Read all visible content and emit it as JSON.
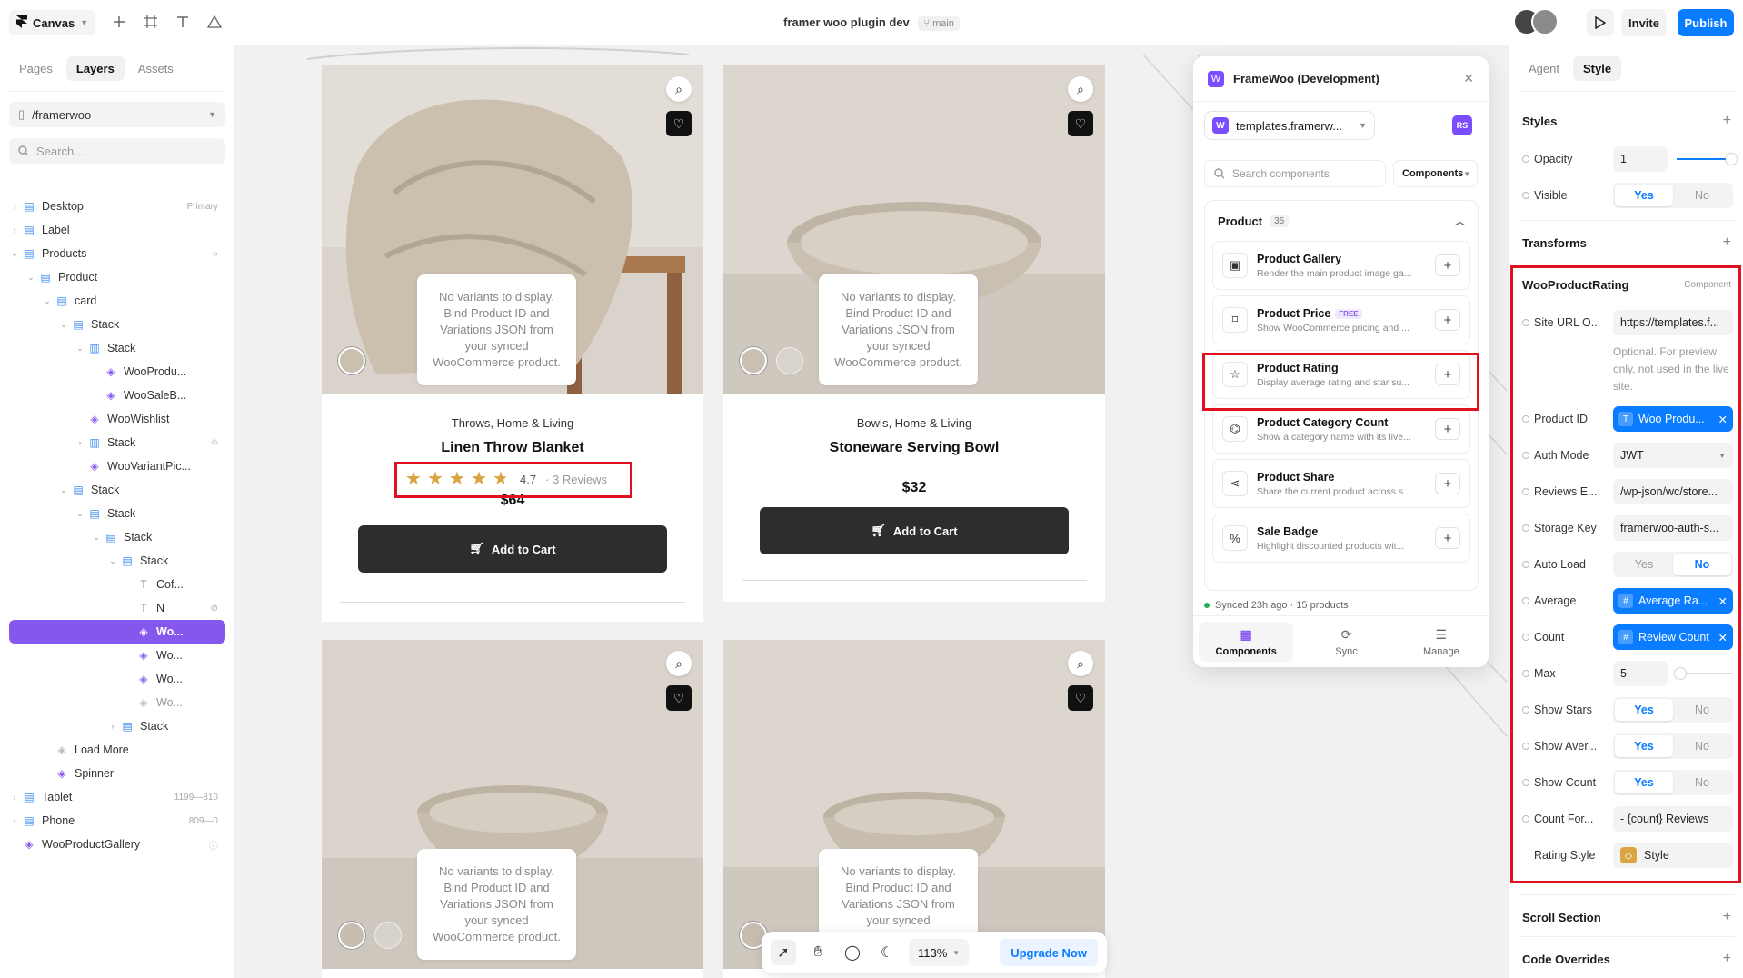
{
  "app": {
    "canvas_label": "Canvas",
    "project_title": "framer woo plugin dev",
    "branch": "main",
    "invite": "Invite",
    "publish": "Publish"
  },
  "left_panel": {
    "tabs": [
      "Pages",
      "Layers",
      "Assets"
    ],
    "path": "/framerwoo",
    "search_placeholder": "Search...",
    "layers": [
      {
        "name": "Desktop",
        "meta": "Primary",
        "icon": "frame-icon"
      },
      {
        "name": "Label",
        "meta": "",
        "icon": "frame-icon"
      },
      {
        "name": "Products",
        "meta": "‹›",
        "icon": "frame-icon"
      },
      {
        "name": "Product",
        "meta": "",
        "icon": "frame-icon"
      },
      {
        "name": "card",
        "meta": "",
        "icon": "frame-icon"
      },
      {
        "name": "Stack",
        "meta": "",
        "icon": "stack-icon"
      },
      {
        "name": "Stack",
        "meta": "",
        "icon": "stack-icon"
      },
      {
        "name": "WooProdu...",
        "meta": "",
        "icon": "component-icon"
      },
      {
        "name": "WooSaleB...",
        "meta": "",
        "icon": "component-icon"
      },
      {
        "name": "WooWishlist",
        "meta": "",
        "icon": "component-icon"
      },
      {
        "name": "Stack",
        "meta": "",
        "icon": "stack-icon"
      },
      {
        "name": "WooVariantPic...",
        "meta": "",
        "icon": "component-icon"
      },
      {
        "name": "Stack",
        "meta": "",
        "icon": "stack-icon"
      },
      {
        "name": "Stack",
        "meta": "",
        "icon": "stack-icon"
      },
      {
        "name": "Stack",
        "meta": "",
        "icon": "stack-icon"
      },
      {
        "name": "Stack",
        "meta": "",
        "icon": "stack-icon"
      },
      {
        "name": "Cof...",
        "meta": "",
        "icon": "text-icon"
      },
      {
        "name": "N",
        "meta": "",
        "icon": "text-icon"
      },
      {
        "name": "Wo...",
        "meta": "",
        "icon": "component-icon"
      },
      {
        "name": "Wo...",
        "meta": "",
        "icon": "component-icon"
      },
      {
        "name": "Wo...",
        "meta": "",
        "icon": "component-icon"
      },
      {
        "name": "Wo...",
        "meta": "",
        "icon": "component-icon"
      },
      {
        "name": "Stack",
        "meta": "",
        "icon": "stack-icon"
      },
      {
        "name": "Load More",
        "meta": "",
        "icon": "component-icon"
      },
      {
        "name": "Spinner",
        "meta": "",
        "icon": "component-icon"
      },
      {
        "name": "Tablet",
        "meta": "1199—810",
        "icon": "frame-icon"
      },
      {
        "name": "Phone",
        "meta": "809—0",
        "icon": "frame-icon"
      },
      {
        "name": "WooProductGallery",
        "meta": "",
        "icon": "component-icon"
      }
    ]
  },
  "cards": [
    {
      "no_variants": "No variants to display. Bind Product ID and Variations JSON from your synced WooCommerce product.",
      "category": "Throws, Home & Living",
      "name": "Linen Throw Blanket",
      "rating": "4.7",
      "reviews": "· 3 Reviews",
      "price": "$64",
      "add_to_cart": "Add to Cart"
    },
    {
      "no_variants": "No variants to display. Bind Product ID and Variations JSON from your synced WooCommerce product.",
      "category": "Bowls, Home & Living",
      "name": "Stoneware Serving Bowl",
      "price": "$32",
      "add_to_cart": "Add to Cart"
    },
    {
      "no_variants": "No variants to display. Bind Product ID and Variations JSON from your synced WooCommerce product."
    },
    {
      "no_variants": "No variants to display. Bind Product ID and Variations JSON from your synced WooCommerce product."
    }
  ],
  "rating_stars": {
    "value": 4.7,
    "max": 5
  },
  "plugin": {
    "title": "FrameWoo (Development)",
    "site": "templates.framerw...",
    "user_initials": "RS",
    "search_placeholder": "Search components",
    "filter": "Components",
    "section_title": "Product",
    "section_count": "35",
    "items": [
      {
        "title": "Product Gallery",
        "desc": "Render the main product image ga...",
        "icon": "image-icon"
      },
      {
        "title": "Product Price",
        "badge": "FREE",
        "desc": "Show WooCommerce pricing and ...",
        "icon": "tag-icon"
      },
      {
        "title": "Product Rating",
        "desc": "Display average rating and star su...",
        "icon": "star-icon"
      },
      {
        "title": "Product Category Count",
        "desc": "Show a category name with its live...",
        "icon": "category-icon"
      },
      {
        "title": "Product Share",
        "desc": "Share the current product across s...",
        "icon": "share-icon"
      },
      {
        "title": "Sale Badge",
        "desc": "Highlight discounted products wit...",
        "icon": "percent-icon"
      }
    ],
    "synced": "Synced 23h ago · 15 products",
    "nav": [
      "Components",
      "Sync",
      "Manage"
    ]
  },
  "right_panel": {
    "tabs": [
      "Agent",
      "Style"
    ],
    "styles_title": "Styles",
    "opacity_label": "Opacity",
    "opacity_value": "1",
    "visible_label": "Visible",
    "transforms_title": "Transforms",
    "component_title": "WooProductRating",
    "component_tag": "Component",
    "site_url_label": "Site URL O...",
    "site_url_value": "https://templates.f...",
    "site_url_hint": "Optional. For preview only, not used in the live site.",
    "product_id_label": "Product ID",
    "product_id_value": "Woo Produ...",
    "auth_mode_label": "Auth Mode",
    "auth_mode_value": "JWT",
    "reviews_endpoint_label": "Reviews E...",
    "reviews_endpoint_value": "/wp-json/wc/store...",
    "storage_key_label": "Storage Key",
    "storage_key_value": "framerwoo-auth-s...",
    "auto_load_label": "Auto Load",
    "average_label": "Average",
    "average_value": "Average Ra...",
    "count_label": "Count",
    "count_value": "Review Count",
    "max_label": "Max",
    "max_value": "5",
    "show_stars_label": "Show Stars",
    "show_average_label": "Show Aver...",
    "show_count_label": "Show Count",
    "count_format_label": "Count For...",
    "count_format_value": "- {count} Reviews",
    "rating_style_label": "Rating Style",
    "rating_style_value": "Style",
    "yes": "Yes",
    "no": "No",
    "scroll_section": "Scroll Section",
    "code_overrides": "Code Overrides"
  },
  "canvas_tools": {
    "zoom": "113%",
    "upgrade": "Upgrade Now"
  },
  "colors": {
    "accent": "#0a7cff",
    "selection": "#8657ec",
    "plugin_brand": "#7c4dff",
    "highlight": "#e0101e",
    "star": "#d9a441"
  }
}
